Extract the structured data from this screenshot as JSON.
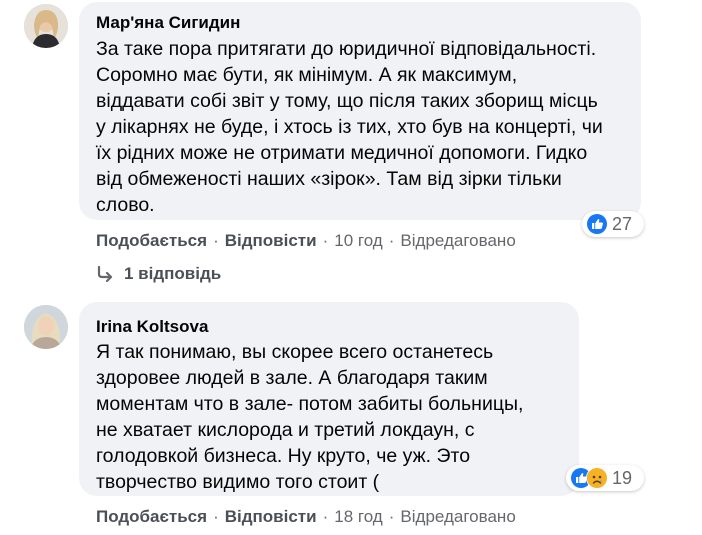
{
  "comments": [
    {
      "author": "Мар'яна Сигидин",
      "text": "За таке пора притягати до юридичної відповідальності.\nСоромно має бути, як мінімум. А як максимум,\nвіддавати собі звіт у тому, що після таких зборищ місць\nу лікарнях не буде, і хтось із тих, хто був на концерті, чи\nїх рідних може не отримати медичної допомоги. Гидко\nвід обмеженості наших «зірок». Там від зірки тільки\nслово.",
      "reactions": {
        "icons": [
          "like-icon"
        ],
        "count": "27"
      },
      "actions": {
        "like": "Подобається",
        "reply": "Відповісти",
        "time": "10 год",
        "edited": "Відредаговано"
      },
      "replies_label": "1 відповідь"
    },
    {
      "author": "Irina Koltsova",
      "text": "Я так понимаю, вы скорее всего останетесь\nздоровее людей в зале. А благодаря таким\nмоментам что в зале- потом забиты больницы,\nне хватает кислорода и третий локдаун, с\nголодовкой бизнеса. Ну круто, че уж. Это\nтворчество видимо того стоит (",
      "reactions": {
        "icons": [
          "like-icon",
          "sad-icon"
        ],
        "count": "19"
      },
      "actions": {
        "like": "Подобається",
        "reply": "Відповісти",
        "time": "18 год",
        "edited": "Відредаговано"
      }
    }
  ],
  "separator": "·",
  "colors": {
    "bubble": "#f0f2f5",
    "like_blue": "#1877f2",
    "sad_yellow": "#f7b125",
    "secondary_text": "#65676b",
    "action_text": "#4b4f56"
  }
}
